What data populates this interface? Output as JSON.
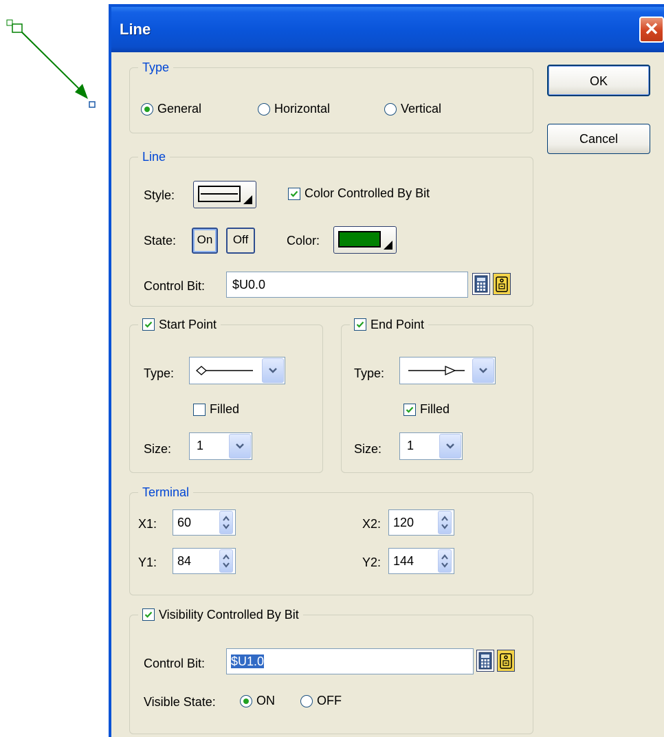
{
  "dialog": {
    "title": "Line",
    "close_glyph": "✕",
    "ok_label": "OK",
    "cancel_label": "Cancel"
  },
  "type_group": {
    "legend": "Type",
    "options": [
      "General",
      "Horizontal",
      "Vertical"
    ],
    "selected": "General"
  },
  "line_group": {
    "legend": "Line",
    "style_label": "Style:",
    "color_controlled_label": "Color Controlled By Bit",
    "color_controlled_checked": true,
    "state_label": "State:",
    "state_on": "On",
    "state_off": "Off",
    "color_label": "Color:",
    "color_value": "#008000",
    "control_bit_label": "Control Bit:",
    "control_bit_value": "$U0.0"
  },
  "start_point": {
    "legend": "Start Point",
    "checked": true,
    "type_label": "Type:",
    "type_icon": "diamond-line-icon",
    "filled_label": "Filled",
    "filled_checked": false,
    "size_label": "Size:",
    "size_value": "1"
  },
  "end_point": {
    "legend": "End Point",
    "checked": true,
    "type_label": "Type:",
    "type_icon": "arrow-line-icon",
    "filled_label": "Filled",
    "filled_checked": true,
    "size_label": "Size:",
    "size_value": "1"
  },
  "terminal": {
    "legend": "Terminal",
    "x1_label": "X1:",
    "x1_value": "60",
    "y1_label": "Y1:",
    "y1_value": "84",
    "x2_label": "X2:",
    "x2_value": "120",
    "y2_label": "Y2:",
    "y2_value": "144"
  },
  "visibility": {
    "legend": "Visibility Controlled By Bit",
    "checked": true,
    "control_bit_label": "Control Bit:",
    "control_bit_value": "$U1.0",
    "visible_state_label": "Visible State:",
    "options": [
      "ON",
      "OFF"
    ],
    "selected": "ON"
  },
  "colors": {
    "accent_blue": "#0046d5",
    "line_green": "#008000",
    "title_bar": "#0a55da"
  }
}
